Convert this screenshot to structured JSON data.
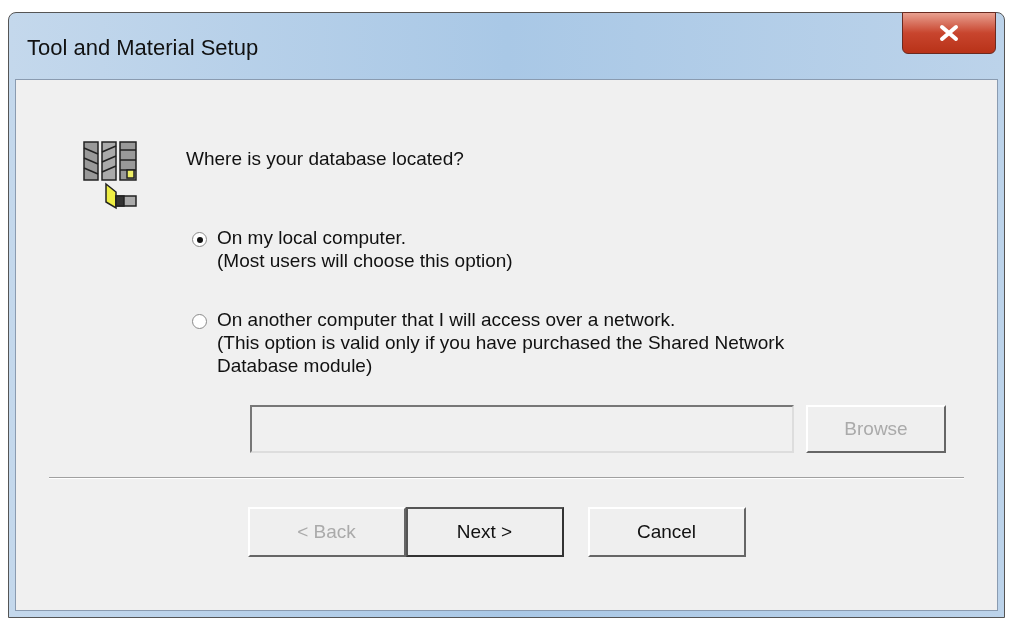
{
  "window": {
    "title": "Tool and Material Setup"
  },
  "question": "Where is your database located?",
  "options": [
    {
      "label": "On my local computer.",
      "note": "(Most users will choose this option)",
      "selected": true
    },
    {
      "label": "On another computer that I will access over a network.",
      "note": "(This option is valid only if you have purchased the Shared Network Database module)",
      "selected": false
    }
  ],
  "path_field": {
    "disabled": true
  },
  "browse_button": {
    "label": "Browse",
    "disabled": true
  },
  "buttons": [
    {
      "label": "< Back",
      "disabled": true,
      "default": false
    },
    {
      "label": "Next >",
      "disabled": false,
      "default": true
    },
    {
      "label": "Cancel",
      "disabled": false,
      "default": false
    }
  ]
}
